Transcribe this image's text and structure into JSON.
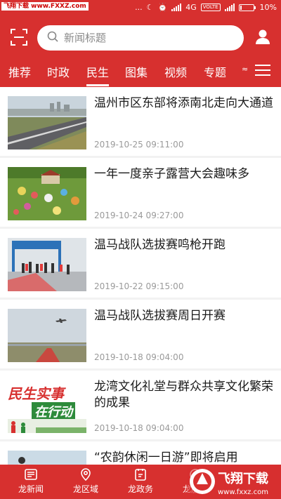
{
  "status_bar": {
    "watermark": "飞翔下载 www.FXXZ.com",
    "network": "4G",
    "volte": "VOLTE",
    "battery": "10%",
    "battery_level": 0.1,
    "dots": "..."
  },
  "search": {
    "placeholder": "新闻标题"
  },
  "tabs": [
    {
      "label": "推荐"
    },
    {
      "label": "时政"
    },
    {
      "label": "民生",
      "active": true
    },
    {
      "label": "图集"
    },
    {
      "label": "视频"
    },
    {
      "label": "专题"
    },
    {
      "label": "≈"
    }
  ],
  "news": [
    {
      "title": "温州市区东部将添南北走向大通道",
      "date": "2019-10-25 09:11:00"
    },
    {
      "title": "一年一度亲子露营大会趣味多",
      "date": "2019-10-24 09:27:00"
    },
    {
      "title": "温马战队选拔赛鸣枪开跑",
      "date": "2019-10-22 09:15:00"
    },
    {
      "title": "温马战队选拔赛周日开赛",
      "date": "2019-10-18 09:04:00"
    },
    {
      "title": "龙湾文化礼堂与群众共享文化繁荣的成果",
      "date": "2019-10-18 09:04:00",
      "thumb_text_1": "民生实事",
      "thumb_text_2": "在行动"
    },
    {
      "title": "“农韵休闲一日游”即将启用",
      "date": ""
    }
  ],
  "bottom_nav": [
    {
      "label": "龙新闻",
      "icon": "news-icon"
    },
    {
      "label": "龙区域",
      "icon": "location-icon"
    },
    {
      "label": "龙政务",
      "icon": "clipboard-icon"
    },
    {
      "label": "龙服务",
      "icon": "service-icon"
    }
  ],
  "watermark_br": {
    "brand": "飞翔下载",
    "url": "www.fxxz.com"
  },
  "colors": {
    "brand_red": "#d7302f",
    "date_gray": "#9a9a9a"
  }
}
